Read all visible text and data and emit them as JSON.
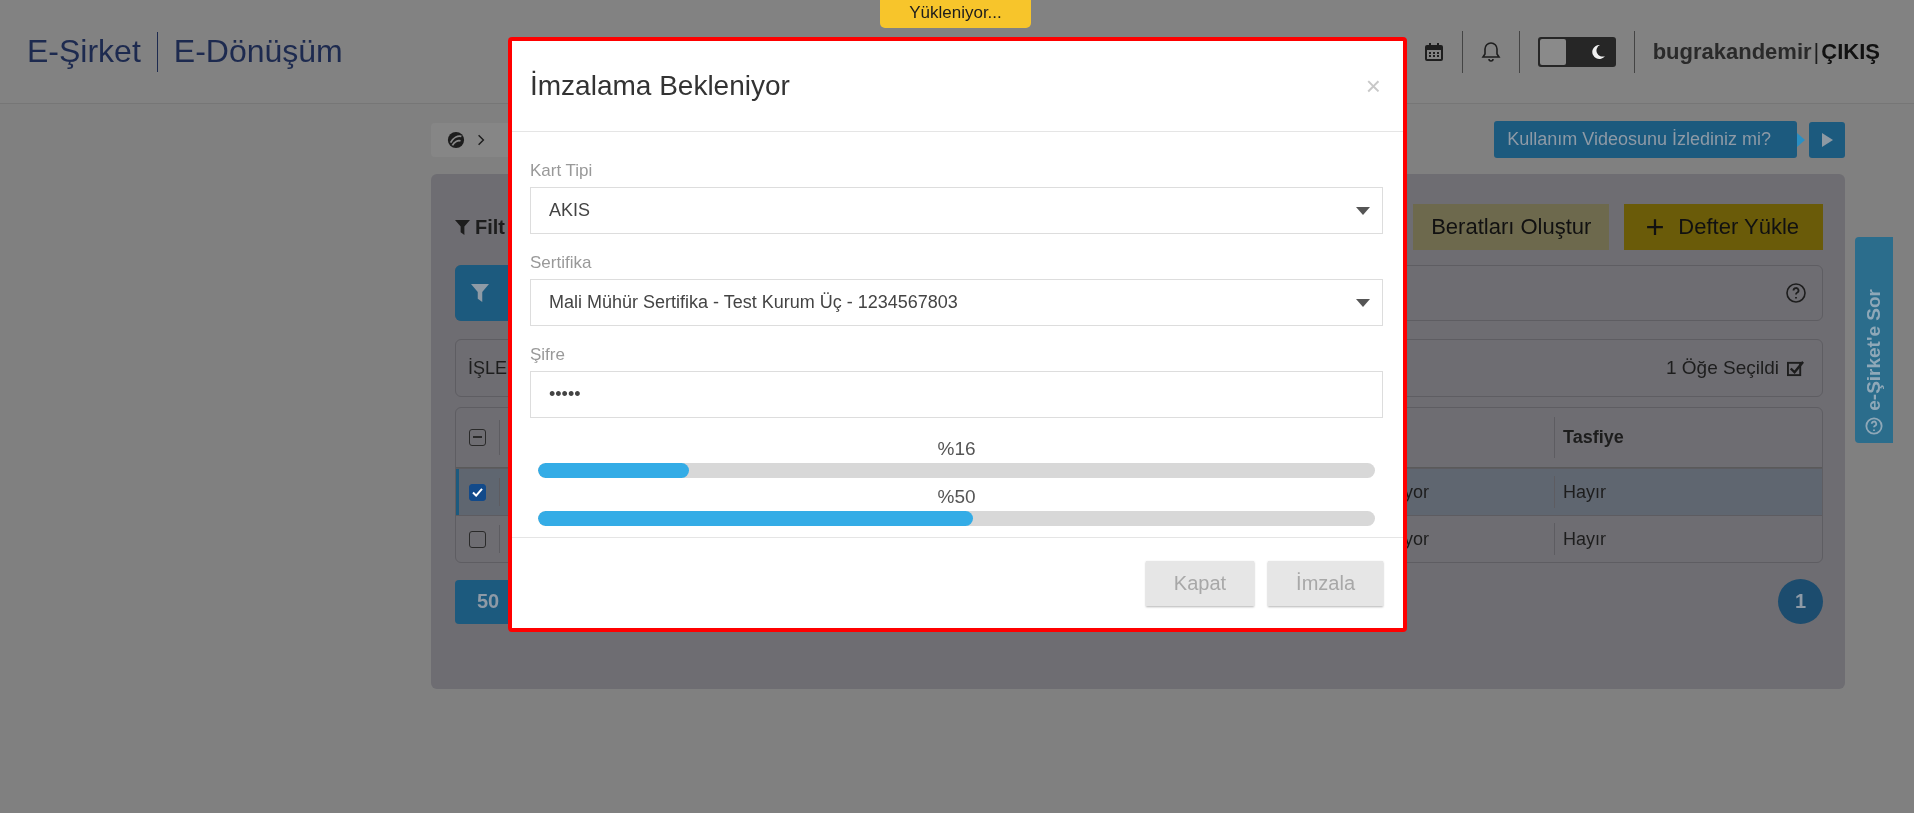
{
  "header": {
    "logo_left": "E-Şirket",
    "logo_right": "E-Dönüşüm",
    "loading_badge": "Yükleniyor...",
    "theme_toggle": {
      "on": false
    },
    "username": "bugrakandemir",
    "separator": "|",
    "logout": "ÇIKIŞ"
  },
  "video_prompt": "Kullanım Videosunu İzlediniz mi?",
  "help_tab": "e-Şirket'e Sor",
  "panel": {
    "filter_title": "Filt",
    "actions": [
      {
        "label": "Beratları Oluştur",
        "kind": "secondary"
      },
      {
        "label": "Defter Yükle",
        "kind": "primary"
      }
    ],
    "bulk_label": "İŞLE",
    "selection_count": "1 Öğe Seçildi",
    "table": {
      "heading_last": "Tasfiye",
      "header_checkbox_indeterminate": true,
      "rows": [
        {
          "selected": true,
          "checked": true,
          "cells": [
            "yor",
            "Hayır"
          ]
        },
        {
          "selected": false,
          "checked": false,
          "cells": [
            "yor",
            "Hayır"
          ]
        }
      ]
    },
    "page_size": "50",
    "pages": [
      {
        "label": "1",
        "selected": true
      }
    ]
  },
  "modal": {
    "title": "İmzalama Bekleniyor",
    "close": "×",
    "fields": [
      {
        "kind": "select",
        "label": "Kart Tipi",
        "value": "AKIS"
      },
      {
        "kind": "select",
        "label": "Sertifika",
        "value": "Mali Mühür Sertifika - Test Kurum Üç - 1234567803"
      },
      {
        "kind": "password",
        "label": "Şifre",
        "value": "•••••"
      }
    ],
    "progress": [
      {
        "reading": "%16",
        "level": 0.18
      },
      {
        "reading": "%50",
        "level": 0.52
      }
    ],
    "buttons": [
      {
        "label": "Kapat",
        "disabled": true
      },
      {
        "label": "İmzala",
        "disabled": true
      }
    ]
  }
}
